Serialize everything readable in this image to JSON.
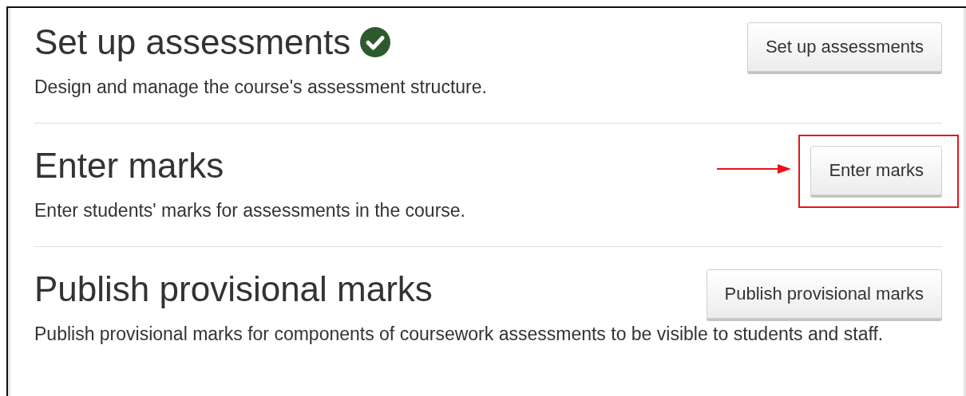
{
  "sections": [
    {
      "title": "Set up assessments",
      "done": true,
      "description": "Design and manage the course's assessment structure.",
      "button": "Set up assessments",
      "highlighted": false
    },
    {
      "title": "Enter marks",
      "done": false,
      "description": "Enter students' marks for assessments in the course.",
      "button": "Enter marks",
      "highlighted": true
    },
    {
      "title": "Publish provisional marks",
      "done": false,
      "description": "Publish provisional marks for components of coursework assessments to be visible to students and staff.",
      "button": "Publish provisional marks",
      "highlighted": false
    }
  ]
}
